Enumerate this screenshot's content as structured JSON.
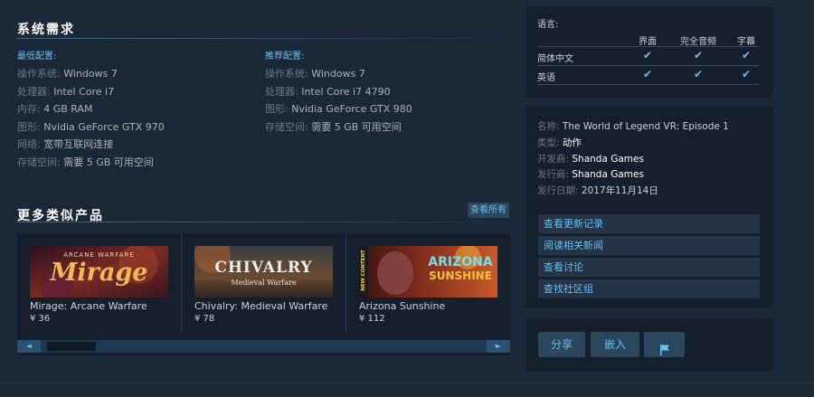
{
  "sysreq": {
    "title": "系统需求",
    "min": {
      "heading": "最低配置:",
      "rows": [
        {
          "k": "操作系统:",
          "v": "Windows 7"
        },
        {
          "k": "处理器:",
          "v": "Intel Core i7"
        },
        {
          "k": "内存:",
          "v": "4 GB RAM"
        },
        {
          "k": "图形:",
          "v": "Nvidia GeForce GTX 970"
        },
        {
          "k": "网络:",
          "v": "宽带互联网连接"
        },
        {
          "k": "存储空间:",
          "v": "需要 5 GB 可用空间"
        }
      ]
    },
    "rec": {
      "heading": "推荐配置:",
      "rows": [
        {
          "k": "操作系统:",
          "v": "Windows 7"
        },
        {
          "k": "处理器:",
          "v": "Intel Core i7 4790"
        },
        {
          "k": "图形:",
          "v": "Nvidia GeForce GTX 980"
        },
        {
          "k": "存储空间:",
          "v": "需要 5 GB 可用空间"
        }
      ]
    }
  },
  "similar": {
    "title": "更多类似产品",
    "view_all": "查看所有",
    "items": [
      {
        "title": "Mirage: Arcane Warfare",
        "price": "¥ 36",
        "art_top": "ARCANE WARFARE",
        "art_main": "Mirage"
      },
      {
        "title": "Chivalry: Medieval Warfare",
        "price": "¥ 78",
        "art_top": "CHIVALRY",
        "art_main": "Medieval Warfare"
      },
      {
        "title": "Arizona Sunshine",
        "price": "¥ 112",
        "art_top": "ARIZONA",
        "art_main": "SUNSHINE",
        "badge": "NEW CONTENT"
      }
    ],
    "scroll_left": "◄",
    "scroll_right": "►"
  },
  "languages": {
    "label": "语言:",
    "columns": [
      "界面",
      "完全音频",
      "字幕"
    ],
    "rows": [
      {
        "name": "简体中文",
        "marks": [
          "✔",
          "✔",
          "✔"
        ]
      },
      {
        "name": "英语",
        "marks": [
          "✔",
          "✔",
          "✔"
        ]
      }
    ]
  },
  "details": {
    "name_k": "名称:",
    "name_v": "The World of Legend VR: Episode 1",
    "genre_k": "类型:",
    "genre_v": "动作",
    "dev_k": "开发商:",
    "dev_v": "Shanda Games",
    "pub_k": "发行商:",
    "pub_v": "Shanda Games",
    "date_k": "发行日期:",
    "date_v": "2017年11月14日",
    "links": [
      "查看更新记录",
      "阅读相关新闻",
      "查看讨论",
      "查找社区组"
    ]
  },
  "share": {
    "share_label": "分享",
    "embed_label": "嵌入",
    "flag_icon": "flag-icon"
  },
  "colors": {
    "accent": "#67c1f5",
    "background": "#1b2838",
    "panel": "#16202d"
  }
}
